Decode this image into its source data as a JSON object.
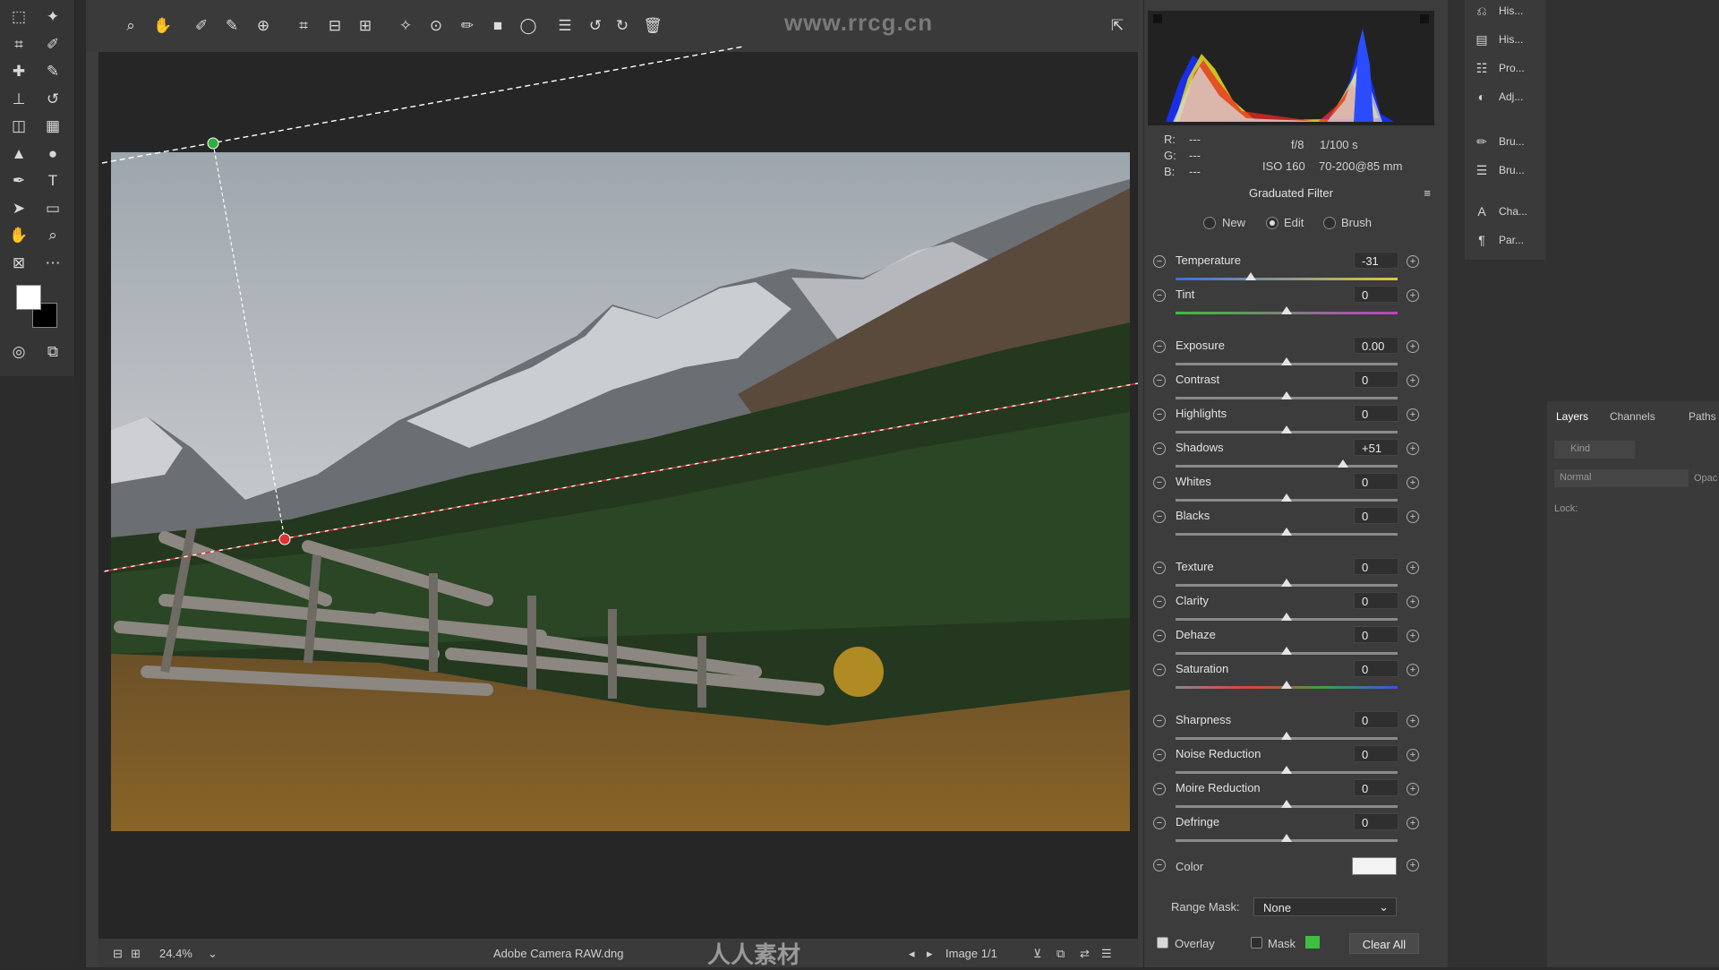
{
  "watermark": "www.rrcg.cn",
  "bottom_watermark": "人人素材",
  "ps_tools": [
    "marquee-icon",
    "magic-wand-icon",
    "crop-icon",
    "eyedropper-icon",
    "healing-icon",
    "brush-icon",
    "stamp-icon",
    "history-brush-icon",
    "eraser-icon",
    "gradient-icon",
    "blur-icon",
    "dodge-icon",
    "pen-icon",
    "type-icon",
    "path-select-icon",
    "shape-icon",
    "hand-icon",
    "zoom-icon",
    "frame-icon",
    "more-icon"
  ],
  "acr_tools": [
    "zoom-icon",
    "hand-icon",
    "white-balance-icon",
    "color-sampler-icon",
    "targeted-adjustment-icon",
    "crop-icon",
    "straighten-icon",
    "transform-icon",
    "spot-removal-icon",
    "red-eye-icon",
    "adjustment-brush-icon",
    "graduated-filter-icon",
    "radial-filter-icon",
    "presets-icon",
    "rotate-left-icon",
    "rotate-right-icon",
    "trash-icon"
  ],
  "readout": {
    "r_label": "R:",
    "r_val": "---",
    "g_label": "G:",
    "g_val": "---",
    "b_label": "B:",
    "b_val": "---",
    "aperture": "f/8",
    "shutter": "1/100 s",
    "iso": "ISO 160",
    "lens": "70-200@85 mm"
  },
  "panel_title": "Graduated Filter",
  "modes": {
    "new": "New",
    "edit": "Edit",
    "brush": "Brush",
    "selected": "Edit"
  },
  "sliders": [
    {
      "label": "Temperature",
      "value": "-31",
      "pos": 0.34,
      "track": "temp"
    },
    {
      "label": "Tint",
      "value": "0",
      "pos": 0.5,
      "track": "tint"
    },
    {
      "label": "Exposure",
      "value": "0.00",
      "pos": 0.5,
      "track": "gray"
    },
    {
      "label": "Contrast",
      "value": "0",
      "pos": 0.5,
      "track": "gray"
    },
    {
      "label": "Highlights",
      "value": "0",
      "pos": 0.5,
      "track": "gray"
    },
    {
      "label": "Shadows",
      "value": "+51",
      "pos": 0.755,
      "track": "gray"
    },
    {
      "label": "Whites",
      "value": "0",
      "pos": 0.5,
      "track": "gray"
    },
    {
      "label": "Blacks",
      "value": "0",
      "pos": 0.5,
      "track": "gray"
    },
    {
      "label": "Texture",
      "value": "0",
      "pos": 0.5,
      "track": "gray"
    },
    {
      "label": "Clarity",
      "value": "0",
      "pos": 0.5,
      "track": "gray"
    },
    {
      "label": "Dehaze",
      "value": "0",
      "pos": 0.5,
      "track": "gray"
    },
    {
      "label": "Saturation",
      "value": "0",
      "pos": 0.5,
      "track": "sat"
    },
    {
      "label": "Sharpness",
      "value": "0",
      "pos": 0.5,
      "track": "gray"
    },
    {
      "label": "Noise Reduction",
      "value": "0",
      "pos": 0.5,
      "track": "gray"
    },
    {
      "label": "Moire Reduction",
      "value": "0",
      "pos": 0.5,
      "track": "gray"
    },
    {
      "label": "Defringe",
      "value": "0",
      "pos": 0.5,
      "track": "gray"
    }
  ],
  "color_label": "Color",
  "range_mask": {
    "label": "Range Mask:",
    "value": "None"
  },
  "footer": {
    "overlay": "Overlay",
    "mask": "Mask",
    "clear_all": "Clear All"
  },
  "bottom_bar": {
    "zoom": "24.4%",
    "filename": "Adobe Camera RAW.dng",
    "image_count": "Image 1/1"
  },
  "ps_panel_items": [
    "His...",
    "His...",
    "Pro...",
    "Adj...",
    "Bru...",
    "Bru...",
    "Cha...",
    "Par..."
  ],
  "layers": {
    "tabs": [
      "Layers",
      "Channels",
      "Paths"
    ],
    "kind_placeholder": "Kind",
    "blend": "Normal",
    "opacity_label": "Opac",
    "lock_label": "Lock:"
  },
  "colors": {
    "accent_green": "#3fbf3f",
    "pin_red": "#e03030",
    "pin_green": "#2fae3f"
  }
}
